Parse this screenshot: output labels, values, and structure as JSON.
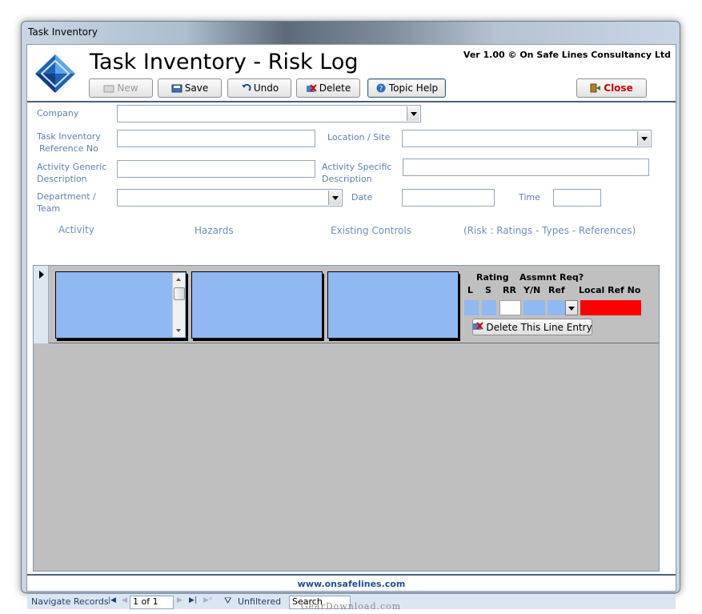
{
  "window": {
    "title": "Task Inventory"
  },
  "header": {
    "title": "Task Inventory - Risk Log",
    "version": "Ver 1.00 © On Safe Lines Consultancy Ltd"
  },
  "toolbar": {
    "new_label": "New",
    "save_label": "Save",
    "undo_label": "Undo",
    "delete_label": "Delete",
    "help_label": "Topic Help",
    "close_label": "Close"
  },
  "form": {
    "company_label": "Company",
    "task_ref_label_1": "Task Inventory",
    "task_ref_label_2": "Reference No",
    "location_label": "Location / Site",
    "activity_generic_label_1": "Activity Generic",
    "activity_generic_label_2": "Description",
    "activity_specific_label_1": "Activity Specific",
    "activity_specific_label_2": "Description",
    "department_label_1": "Department /",
    "department_label_2": "Team",
    "date_label": "Date",
    "time_label": "Time",
    "company_value": "",
    "task_ref_value": "",
    "location_value": "",
    "activity_generic_value": "",
    "activity_specific_value": "",
    "department_value": "",
    "date_value": "",
    "time_value": ""
  },
  "columns": {
    "activity": "Activity",
    "hazards": "Hazards",
    "controls": "Existing Controls",
    "risk": "(Risk : Ratings - Types - References)"
  },
  "row": {
    "rating_header": "Rating",
    "assmnt_header": "Assmnt Req?",
    "l": "L",
    "s": "S",
    "rr": "RR",
    "yn": "Y/N",
    "ref": "Ref",
    "local_ref": "Local Ref No",
    "delete_line_label": "Delete This Line Entry"
  },
  "footer": {
    "website": "www.onsafelines.com",
    "navigate_label": "Navigate Records",
    "record_position": "1 of 1",
    "filter_label": "Unfiltered",
    "search_label": "Search"
  },
  "watermark": "GearDownload.com",
  "colors": {
    "accent_blue": "#90b8f2",
    "local_ref_red": "#ff0000",
    "label_blue": "#5b7fb0",
    "close_red": "#d10000"
  }
}
